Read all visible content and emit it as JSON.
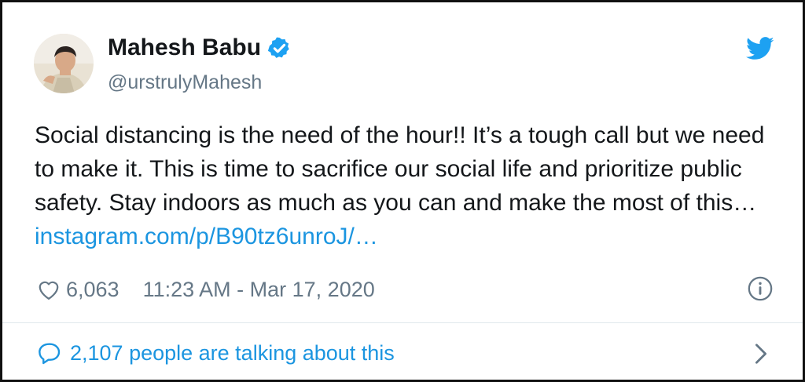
{
  "author": {
    "name": "Mahesh Babu",
    "handle": "@urstrulyMahesh",
    "verified": true
  },
  "tweet": {
    "text": "Social distancing is the need of the hour!! It’s a tough call but we need to make it. This is time to sacrifice our social life and prioritize public safety.  Stay indoors as much as you can and make the most of this… ",
    "link": "instagram.com/p/B90tz6unroJ/…"
  },
  "stats": {
    "likes": "6,063",
    "timestamp": "11:23 AM - Mar 17, 2020"
  },
  "conversation": {
    "label": "2,107 people are talking about this"
  },
  "icons": {
    "brand": "twitter-bird-icon",
    "verified": "verified-badge-icon",
    "like": "heart-icon",
    "info": "info-icon",
    "reply": "speech-bubble-icon",
    "more": "chevron-right-icon"
  },
  "colors": {
    "brand_blue": "#1da1f2",
    "link_blue": "#1b95e0",
    "text": "#14171a",
    "muted": "#657786"
  }
}
